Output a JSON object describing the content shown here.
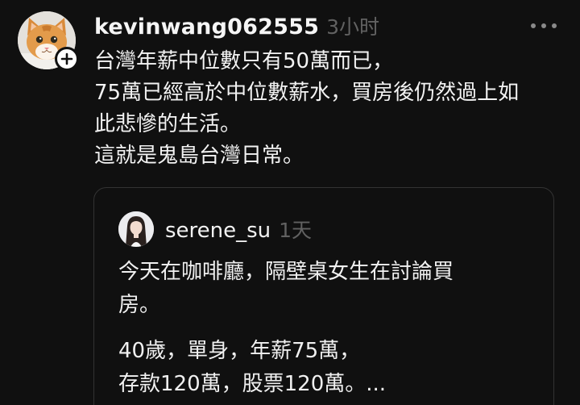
{
  "post": {
    "username": "kevinwang062555",
    "time": "3小时",
    "lines": [
      "台灣年薪中位數只有50萬而已，",
      "75萬已經高於中位數薪水，買房後仍然過上如",
      "此悲慘的生活。",
      "這就是鬼島台灣日常。"
    ]
  },
  "quote": {
    "username": "serene_su",
    "time": "1天",
    "paragraph1": [
      "今天在咖啡廳，隔壁桌女生在討論買",
      "房。"
    ],
    "paragraph2": [
      "40歲，單身，年薪75萬，",
      "存款120萬，股票120萬。..."
    ]
  },
  "icons": {
    "avatar": "orange-cat-avatar",
    "follow": "plus-icon",
    "more": "more-dots-icon",
    "quote_avatar": "woman-avatar"
  },
  "colors": {
    "background": "#101010",
    "text": "#f3f3f3",
    "muted": "#616161",
    "card_border": "#333333"
  }
}
